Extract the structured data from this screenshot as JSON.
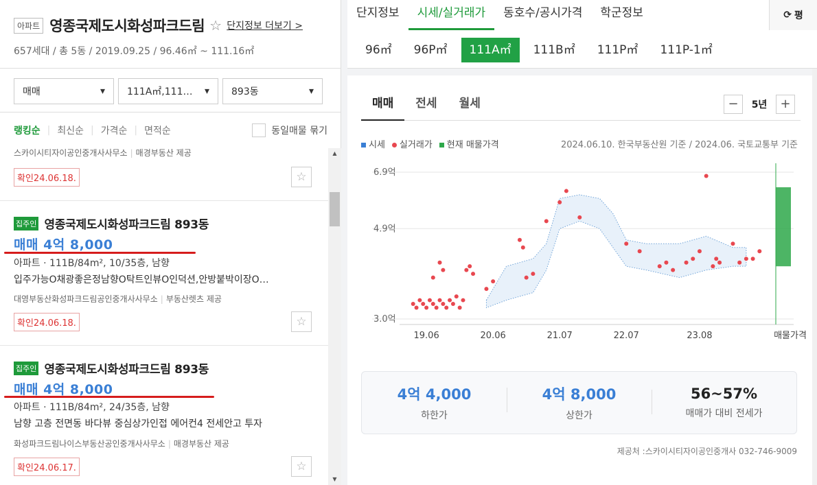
{
  "complex": {
    "type_badge": "아파트",
    "name": "영종국제도시화성파크드림",
    "star_icon": "☆",
    "more_link": "단지정보 더보기 >",
    "subinfo": "657세대 / 총 5동 / 2019.09.25 / 96.46㎡ ~ 111.16㎡"
  },
  "filters": {
    "trade": "매매",
    "area": "111A㎡,111…",
    "dong": "893동",
    "chevron": "▾"
  },
  "sort": {
    "ranking": "랭킹순",
    "latest": "최신순",
    "price": "가격순",
    "area": "면적순",
    "bundle_label": "동일매물 묶기"
  },
  "listings": [
    {
      "realtor": "스카이시티자이공인중개사사무소",
      "provider": "매경부동산 제공",
      "confirm": "확인24.06.18."
    },
    {
      "badge": "집주인",
      "title": "영종국제도시화성파크드림 893동",
      "price": "매매 4억 8,000",
      "spec": "아파트 · 111B/84m², 10/35층, 남향",
      "desc": "입주가능O채광좋은정남향O탁트인뷰O인덕션,안방붙박이장O…",
      "realtor": "대영부동산화성파크드림공인중개사사무소",
      "provider": "부동산렛츠 제공",
      "confirm": "확인24.06.18."
    },
    {
      "badge": "집주인",
      "title": "영종국제도시화성파크드림 893동",
      "price": "매매 4억 8,000",
      "spec": "아파트 · 111B/84m², 24/35층, 남향",
      "desc": "남향 고층 전면동 바다뷰 중심상가인접 에어컨4 전세안고 투자",
      "realtor": "화성파크드림나이스부동산공인중개사사무소",
      "provider": "매경부동산 제공",
      "confirm": "확인24.06.17."
    }
  ],
  "top_tabs": [
    "단지정보",
    "시세/실거래가",
    "동호수/공시가격",
    "학군정보"
  ],
  "pyeong_toggle": "평",
  "sizes": [
    "96㎡",
    "96P㎡",
    "111A㎡",
    "111B㎡",
    "111P㎡",
    "111P-1㎡"
  ],
  "price_tabs": [
    "매매",
    "전세",
    "월세"
  ],
  "period": {
    "minus": "−",
    "label": "5년",
    "plus": "+"
  },
  "legend": {
    "market": "시세",
    "actual": "실거래가",
    "listing": "현재 매물가격",
    "basis": "2024.06.10. 한국부동산원 기준 / 2024.06. 국토교통부 기준"
  },
  "colors": {
    "market": "#3a7fd5",
    "actual": "#e84850",
    "listing": "#2ea84a",
    "accent": "#1e9a3a"
  },
  "chart_data": {
    "type": "scatter",
    "y_ticks": [
      "6.9억",
      "4.9억",
      "3.0억"
    ],
    "x_ticks": [
      "19.06",
      "20.06",
      "21.07",
      "22.07",
      "23.08",
      "매물가격"
    ],
    "ylim": [
      3.0,
      6.9
    ],
    "market_band": {
      "upper": [
        [
          2020.5,
          3.5
        ],
        [
          2020.8,
          4.4
        ],
        [
          2021.2,
          4.6
        ],
        [
          2021.4,
          5.0
        ],
        [
          2021.6,
          6.2
        ],
        [
          2021.9,
          6.3
        ],
        [
          2022.2,
          6.2
        ],
        [
          2022.4,
          5.8
        ],
        [
          2022.6,
          5.1
        ],
        [
          2022.9,
          5.0
        ],
        [
          2023.4,
          5.0
        ],
        [
          2023.8,
          5.2
        ],
        [
          2024.2,
          4.9
        ],
        [
          2024.4,
          4.9
        ]
      ],
      "lower": [
        [
          2020.5,
          3.3
        ],
        [
          2020.8,
          3.5
        ],
        [
          2021.2,
          3.7
        ],
        [
          2021.4,
          4.3
        ],
        [
          2021.6,
          5.4
        ],
        [
          2021.9,
          5.6
        ],
        [
          2022.2,
          5.4
        ],
        [
          2022.4,
          4.9
        ],
        [
          2022.6,
          4.4
        ],
        [
          2022.9,
          4.3
        ],
        [
          2023.4,
          4.1
        ],
        [
          2023.8,
          4.3
        ],
        [
          2024.2,
          4.4
        ],
        [
          2024.4,
          4.4
        ]
      ]
    },
    "actual_trades": [
      [
        2019.4,
        3.4
      ],
      [
        2019.45,
        3.3
      ],
      [
        2019.5,
        3.5
      ],
      [
        2019.55,
        3.4
      ],
      [
        2019.6,
        3.3
      ],
      [
        2019.65,
        3.5
      ],
      [
        2019.7,
        3.4
      ],
      [
        2019.75,
        3.3
      ],
      [
        2019.8,
        3.5
      ],
      [
        2019.85,
        3.4
      ],
      [
        2019.9,
        3.3
      ],
      [
        2019.95,
        3.5
      ],
      [
        2020.0,
        3.4
      ],
      [
        2020.05,
        3.6
      ],
      [
        2020.1,
        3.3
      ],
      [
        2020.15,
        3.5
      ],
      [
        2019.7,
        4.1
      ],
      [
        2019.8,
        4.5
      ],
      [
        2019.85,
        4.3
      ],
      [
        2020.2,
        4.3
      ],
      [
        2020.25,
        4.4
      ],
      [
        2020.3,
        4.2
      ],
      [
        2020.5,
        3.8
      ],
      [
        2020.6,
        4.0
      ],
      [
        2021.0,
        5.1
      ],
      [
        2021.05,
        4.9
      ],
      [
        2021.1,
        4.1
      ],
      [
        2021.2,
        4.2
      ],
      [
        2021.4,
        5.6
      ],
      [
        2021.6,
        6.1
      ],
      [
        2021.7,
        6.4
      ],
      [
        2021.9,
        5.7
      ],
      [
        2022.6,
        5.0
      ],
      [
        2022.8,
        4.8
      ],
      [
        2023.1,
        4.4
      ],
      [
        2023.2,
        4.5
      ],
      [
        2023.3,
        4.3
      ],
      [
        2023.5,
        4.5
      ],
      [
        2023.6,
        4.6
      ],
      [
        2023.7,
        4.8
      ],
      [
        2023.8,
        6.8
      ],
      [
        2023.9,
        4.4
      ],
      [
        2023.95,
        4.6
      ],
      [
        2024.0,
        4.5
      ],
      [
        2024.2,
        5.0
      ],
      [
        2024.3,
        4.5
      ],
      [
        2024.4,
        4.6
      ],
      [
        2024.5,
        4.6
      ],
      [
        2024.6,
        4.8
      ]
    ],
    "current_listings": {
      "low": 4.4,
      "high": 6.5
    }
  },
  "summary": [
    {
      "value": "4억 4,000",
      "label": "하한가"
    },
    {
      "value": "4억 8,000",
      "label": "상한가"
    },
    {
      "value": "56~57%",
      "label": "매매가 대비 전세가"
    }
  ],
  "source": "제공처 :스카이시티자이공인중개사 032-746-9009"
}
